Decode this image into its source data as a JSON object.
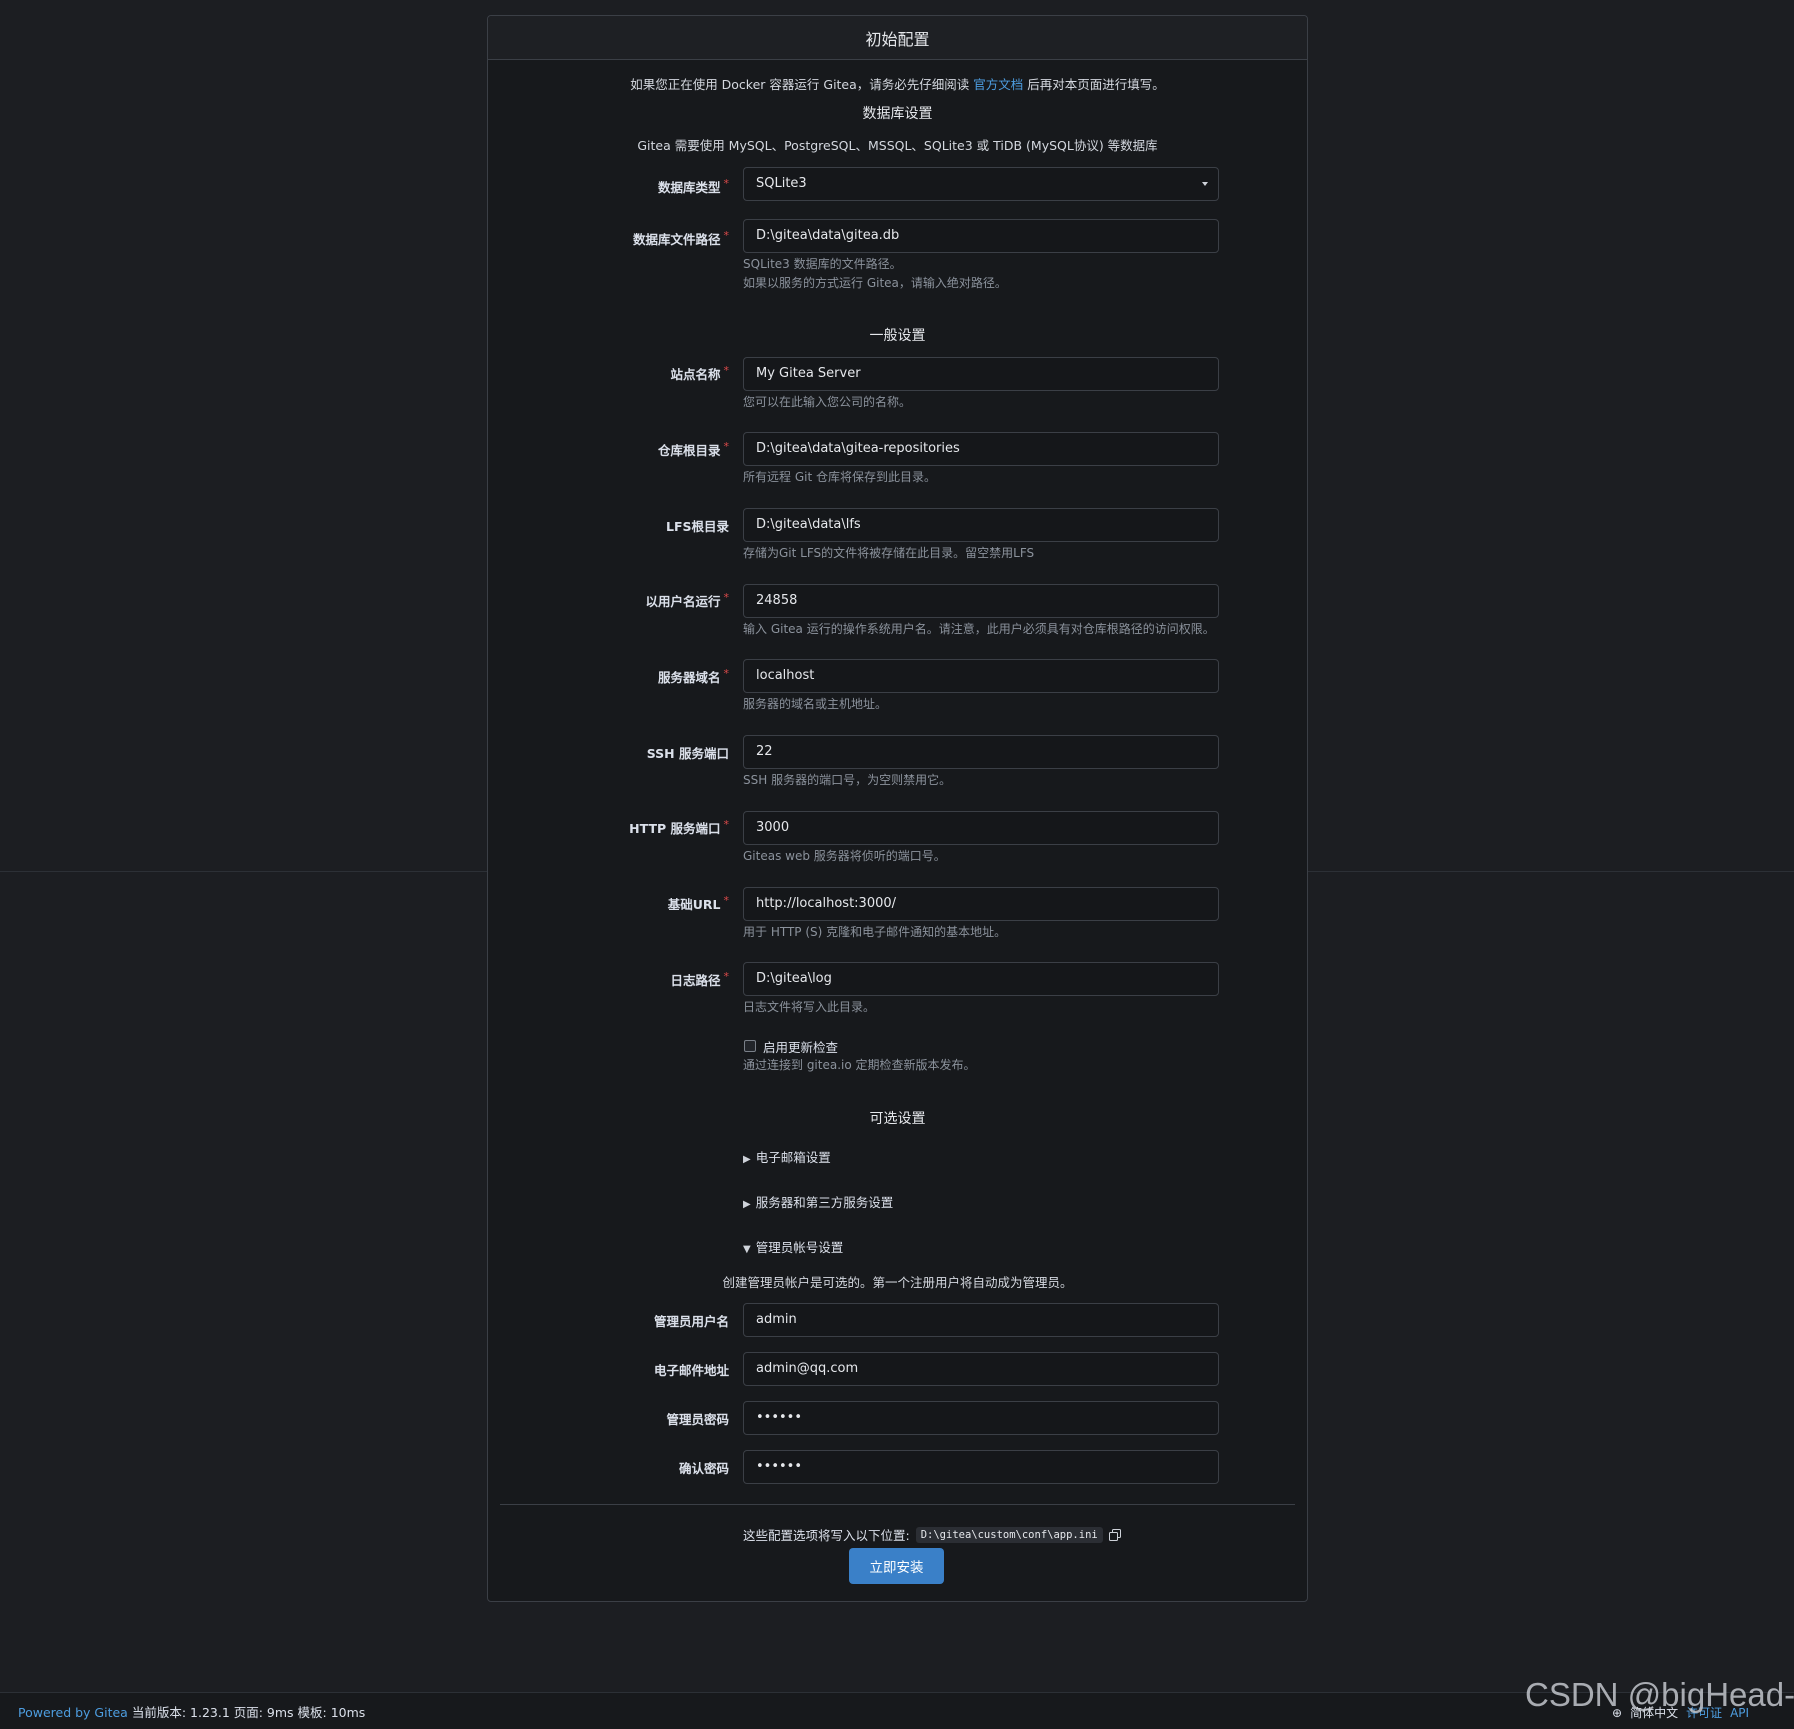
{
  "header": {
    "title": "初始配置"
  },
  "intro": {
    "before": "如果您正在使用 Docker 容器运行 Gitea，请务必先仔细阅读",
    "link": "官方文档",
    "after": "后再对本页面进行填写。"
  },
  "db_section": {
    "title": "数据库设置",
    "desc": "Gitea 需要使用 MySQL、PostgreSQL、MSSQL、SQLite3 或 TiDB (MySQL协议) 等数据库",
    "type_label": "数据库类型",
    "type_value": "SQLite3",
    "path_label": "数据库文件路径",
    "path_value": "D:\\gitea\\data\\gitea.db",
    "path_help1": "SQLite3 数据库的文件路径。",
    "path_help2": "如果以服务的方式运行 Gitea，请输入绝对路径。"
  },
  "general_section": {
    "title": "一般设置",
    "fields": {
      "site_name": {
        "label": "站点名称",
        "value": "My Gitea Server",
        "help": "您可以在此输入您公司的名称。"
      },
      "repo_root": {
        "label": "仓库根目录",
        "value": "D:\\gitea\\data\\gitea-repositories",
        "help": "所有远程 Git 仓库将保存到此目录。"
      },
      "lfs_root": {
        "label": "LFS根目录",
        "value": "D:\\gitea\\data\\lfs",
        "help": "存储为Git LFS的文件将被存储在此目录。留空禁用LFS"
      },
      "run_user": {
        "label": "以用户名运行",
        "value": "24858",
        "help": "输入 Gitea 运行的操作系统用户名。请注意，此用户必须具有对仓库根路径的访问权限。"
      },
      "domain": {
        "label": "服务器域名",
        "value": "localhost",
        "help": "服务器的域名或主机地址。"
      },
      "ssh_port": {
        "label": "SSH 服务端口",
        "value": "22",
        "help": "SSH 服务器的端口号，为空则禁用它。"
      },
      "http_port": {
        "label": "HTTP 服务端口",
        "value": "3000",
        "help": "Giteas web 服务器将侦听的端口号。"
      },
      "base_url": {
        "label": "基础URL",
        "value": "http://localhost:3000/",
        "help": "用于 HTTP (S) 克隆和电子邮件通知的基本地址。"
      },
      "log_path": {
        "label": "日志路径",
        "value": "D:\\gitea\\log",
        "help": "日志文件将写入此目录。"
      }
    },
    "update_check": {
      "label": "启用更新检查",
      "checked": false,
      "help": "通过连接到 gitea.io 定期检查新版本发布。"
    }
  },
  "optional_section": {
    "title": "可选设置",
    "email": {
      "label": "电子邮箱设置",
      "icon": "triangle-right-icon"
    },
    "server": {
      "label": "服务器和第三方服务设置",
      "icon": "triangle-right-icon"
    },
    "admin": {
      "label": "管理员帐号设置",
      "icon": "triangle-down-icon"
    },
    "admin_desc": "创建管理员帐户是可选的。第一个注册用户将自动成为管理员。",
    "admin_username": {
      "label": "管理员用户名",
      "value": "admin"
    },
    "admin_email": {
      "label": "电子邮件地址",
      "value": "admin@qq.com"
    },
    "admin_password": {
      "label": "管理员密码",
      "value": "••••••"
    },
    "confirm_password": {
      "label": "确认密码",
      "value": "••••••"
    }
  },
  "config_write": {
    "text": "这些配置选项将写入以下位置:",
    "path": "D:\\gitea\\custom\\conf\\app.ini"
  },
  "install_button": "立即安装",
  "footer": {
    "powered": "Powered by Gitea",
    "version": "当前版本: 1.23.1 页面: 9ms 模板: 10ms",
    "language": "简体中文",
    "license": "许可证",
    "api": "API"
  },
  "watermark": "CSDN @bigHead-",
  "colors": {
    "background": "#1c1e22",
    "card": "#17191c",
    "accent": "#3a80c8",
    "link": "#4d9de0",
    "required": "#db4a4a"
  }
}
